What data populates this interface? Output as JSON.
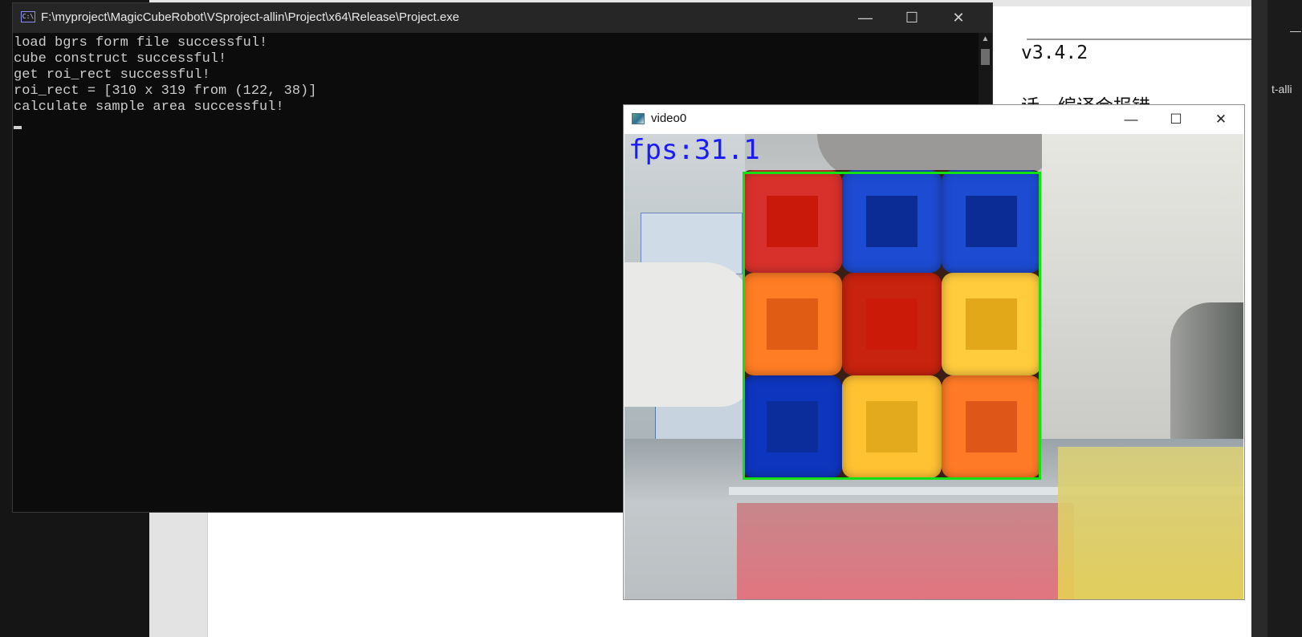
{
  "background_editor": {
    "text_line1": "v3.4.2",
    "text_line2": "话，编译会报错",
    "side_label": "t-alli",
    "side_dash": "—"
  },
  "console": {
    "title": "F:\\myproject\\MagicCubeRobot\\VSproject-allin\\Project\\x64\\Release\\Project.exe",
    "icon_text": "C:\\",
    "lines": [
      "load bgrs form file successful!",
      "cube construct successful!",
      "get roi_rect successful!",
      "roi_rect = [310 x 319 from (122, 38)]",
      "calculate sample area successful!"
    ],
    "controls": {
      "minimize": "—",
      "maximize": "☐",
      "close": "✕"
    }
  },
  "video_window": {
    "title": "video0",
    "fps_text": "fps:31.1",
    "controls": {
      "minimize": "—",
      "maximize": "☐",
      "close": "✕"
    },
    "roi_color": "#14e114",
    "cube_stickers": [
      {
        "row": 0,
        "col": 0,
        "color": "#d8312c",
        "sample": "#c8190a"
      },
      {
        "row": 0,
        "col": 1,
        "color": "#1d4bd1",
        "sample": "#0b2c94"
      },
      {
        "row": 0,
        "col": 2,
        "color": "#1d4bd1",
        "sample": "#0b2c94"
      },
      {
        "row": 1,
        "col": 0,
        "color": "#ff7d24",
        "sample": "#e05b14"
      },
      {
        "row": 1,
        "col": 1,
        "color": "#c8230e",
        "sample": "#cc1a08"
      },
      {
        "row": 1,
        "col": 2,
        "color": "#ffcc3d",
        "sample": "#e2a81a"
      },
      {
        "row": 2,
        "col": 0,
        "color": "#0e35bd",
        "sample": "#0b2c9b"
      },
      {
        "row": 2,
        "col": 1,
        "color": "#ffc233",
        "sample": "#e2aa1c"
      },
      {
        "row": 2,
        "col": 2,
        "color": "#ff7a26",
        "sample": "#df5718"
      }
    ]
  }
}
